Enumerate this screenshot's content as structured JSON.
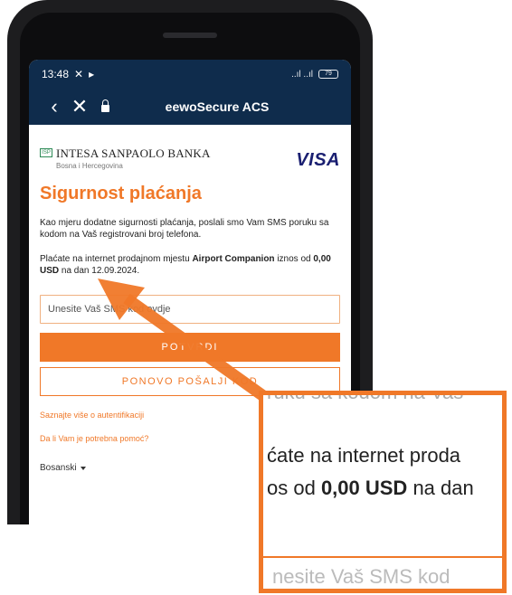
{
  "status_bar": {
    "time": "13:48",
    "signal": "..ıl ..ıl",
    "battery": "79"
  },
  "app_bar": {
    "title": "eewoSecure ACS"
  },
  "bank": {
    "name": "INTESA SANPAOLO BANKA",
    "subtitle": "Bosna i Hercegovina"
  },
  "card_network": "VISA",
  "page_title": "Sigurnost plaćanja",
  "info_text": "Kao mjeru dodatne sigurnosti plaćanja, poslali smo Vam SMS poruku sa kodom na Vaš registrovani broj telefona.",
  "payment": {
    "prefix": "Plaćate na internet prodajnom mjestu ",
    "merchant": "Airport Companion",
    "middle": " iznos od ",
    "amount": "0,00 USD",
    "suffix": " na dan 12.09.2024."
  },
  "form": {
    "sms_placeholder": "Unesite Vaš SMS kod ovdje",
    "confirm_label": "POTVRDI",
    "resend_label": "PONOVO POŠALJI KOD"
  },
  "links": {
    "auth_info": "Saznajte više o autentifikaciji",
    "help": "Da li Vam je potrebna pomoć?"
  },
  "language": "Bosanski",
  "zoom": {
    "top_text": "ruku sa kodom na Vaš",
    "line1": "ćate na internet proda",
    "line2_prefix": "os od ",
    "line2_amount": "0,00 USD",
    "line2_suffix": " na dan",
    "bottom_text": "nesite Vaš SMS kod"
  },
  "colors": {
    "accent": "#f07828",
    "header": "#0f2c4c",
    "visa": "#1a1f71"
  }
}
